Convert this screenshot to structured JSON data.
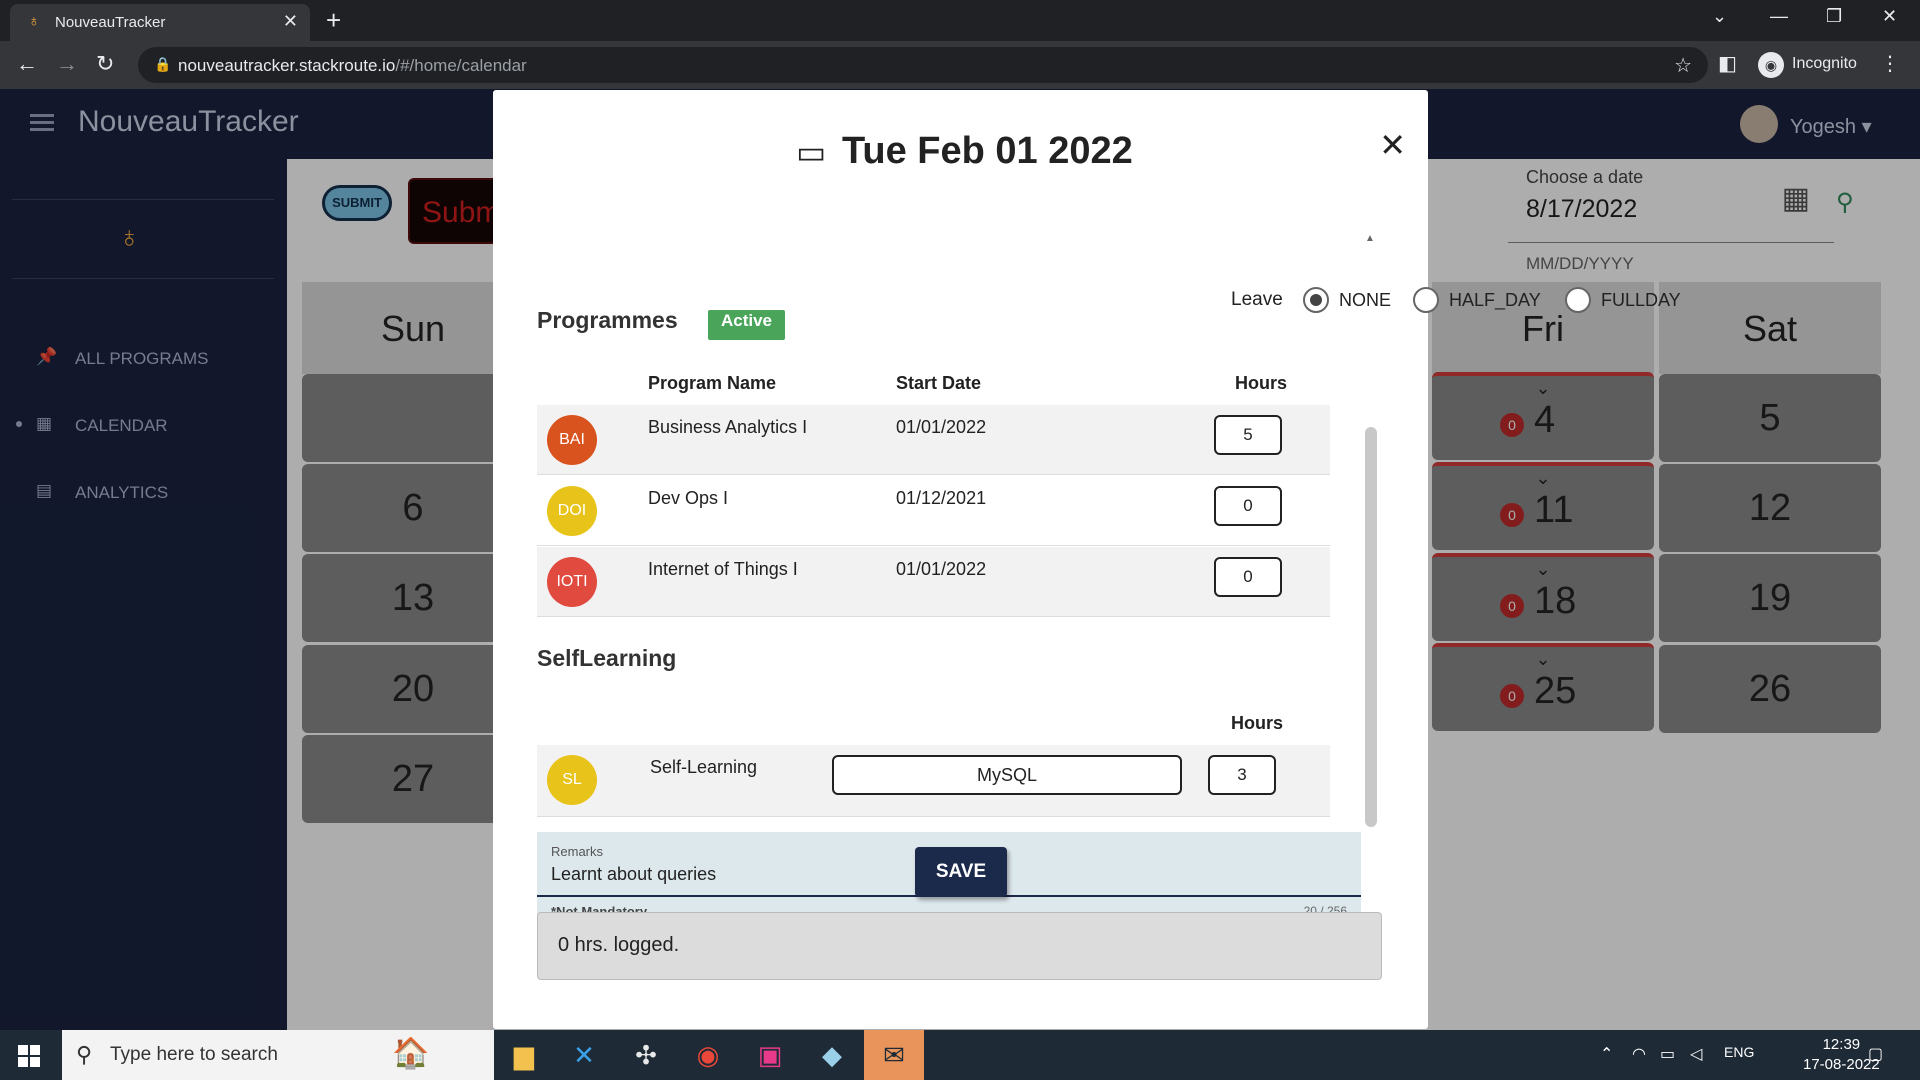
{
  "browser": {
    "tab_title": "NouveauTracker",
    "url_host": "nouveautracker.stackroute.io",
    "url_path": "/#/home/calendar",
    "profile": "Incognito"
  },
  "app": {
    "brand": "NouveauTracker",
    "user_name": "Yogesh",
    "sidebar": [
      {
        "label": "ALL PROGRAMS",
        "icon": "pin-icon"
      },
      {
        "label": "CALENDAR",
        "icon": "calendar-icon"
      },
      {
        "label": "ANALYTICS",
        "icon": "document-icon"
      }
    ],
    "submit_badge": "SUBMIT",
    "submit_button": "Subm",
    "date_picker": {
      "label": "Choose a date",
      "value": "8/17/2022",
      "hint": "MM/DD/YYYY"
    },
    "calendar": {
      "days": [
        "Sun",
        "Fri",
        "Sat"
      ],
      "sun_dates": [
        "6",
        "13",
        "20",
        "27"
      ],
      "fri_dates": [
        "4",
        "11",
        "18",
        "25"
      ],
      "fri_badges": [
        "0",
        "0",
        "0",
        "0"
      ],
      "sat_dates": [
        "5",
        "12",
        "19",
        "26"
      ]
    }
  },
  "modal": {
    "title": "Tue Feb 01 2022",
    "leave": {
      "label": "Leave",
      "options": [
        "NONE",
        "HALF_DAY",
        "FULLDAY"
      ],
      "selected": "NONE"
    },
    "programmes_title": "Programmes",
    "active_badge": "Active",
    "columns": {
      "name": "Program Name",
      "start": "Start Date",
      "hours": "Hours"
    },
    "programs": [
      {
        "initials": "BAI",
        "name": "Business Analytics I",
        "start": "01/01/2022",
        "hours": "5",
        "color": "#d9531e"
      },
      {
        "initials": "DOI",
        "name": "Dev Ops I",
        "start": "01/12/2021",
        "hours": "0",
        "color": "#e8c31a"
      },
      {
        "initials": "IOTI",
        "name": "Internet of Things I",
        "start": "01/01/2022",
        "hours": "0",
        "color": "#e04a3f"
      }
    ],
    "self_learning_title": "SelfLearning",
    "self_learning": {
      "initials": "SL",
      "name": "Self-Learning",
      "skill": "MySQL",
      "hours": "3",
      "color": "#e8c31a",
      "hours_header": "Hours"
    },
    "remarks": {
      "label": "Remarks",
      "value": "Learnt about queries",
      "hint": "*Not Mandatory",
      "counter": "20 / 256"
    },
    "save_label": "SAVE",
    "logged_text": "0 hrs. logged."
  },
  "taskbar": {
    "search_placeholder": "Type here to search",
    "lang": "ENG",
    "time": "12:39",
    "date": "17-08-2022"
  }
}
